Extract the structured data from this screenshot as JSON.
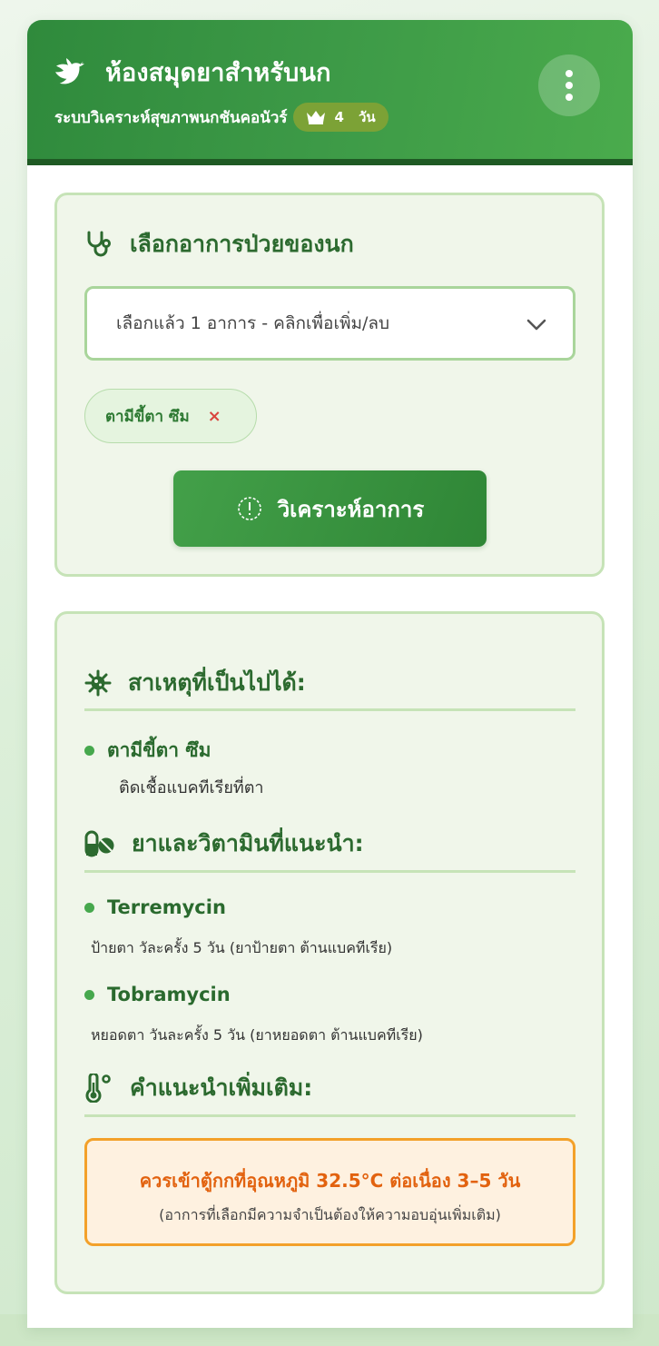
{
  "header": {
    "title": "ห้องสมุดยาสำหรับนก",
    "subtitle": "ระบบวิเคราะห์สุขภาพนกชันคอนัวร์",
    "badge_days": "4",
    "badge_unit": "วัน"
  },
  "symptom_select": {
    "title": "เลือกอาการป่วยของนก",
    "dropdown_text": "เลือกแล้ว 1 อาการ - คลิกเพื่อเพิ่ม/ลบ",
    "selected_chips": [
      {
        "label": "ตามีขี้ตา ซึม",
        "remove": "×"
      }
    ],
    "analyze_label": "วิเคราะห์อาการ"
  },
  "results": {
    "causes_title": "สาเหตุที่เป็นไปได้:",
    "causes": [
      {
        "symptom": "ตามีขี้ตา ซึม",
        "cause": "ติดเชื้อแบคทีเรียที่ตา"
      }
    ],
    "meds_title": "ยาและวิตามินที่แนะนำ:",
    "meds": [
      {
        "name": "Terremycin",
        "usage": "ป้ายตา วัละครั้ง 5 วัน (ยาป้ายตา ต้านแบคทีเรีย)"
      },
      {
        "name": "Tobramycin",
        "usage": "หยอดตา วันละครั้ง 5 วัน (ยาหยอดตา ต้านแบคทีเรีย)"
      }
    ],
    "advice_title": "คำแนะนำเพิ่มเติม:",
    "advice_main": "ควรเข้าตู้กกที่อุณหภูมิ 32.5°C ต่อเนื่อง 3–5 วัน",
    "advice_sub": "(อาการที่เลือกมีความจำเป็นต้องให้ความอบอุ่นเพิ่มเติม)"
  },
  "icons": {
    "header_logo": "dove-icon",
    "badge": "crown-icon",
    "menu": "kebab-menu-icon",
    "symptom": "stethoscope-icon",
    "dropdown": "chevron-down-icon",
    "analyze": "info-circle-icon",
    "causes": "virus-icon",
    "meds": "pills-icon",
    "advice": "thermometer-icon"
  },
  "colors": {
    "primary": "#2f8a3c",
    "accent_light": "#f0f6ea",
    "warning": "#e2620f",
    "remove": "#d9453e"
  }
}
